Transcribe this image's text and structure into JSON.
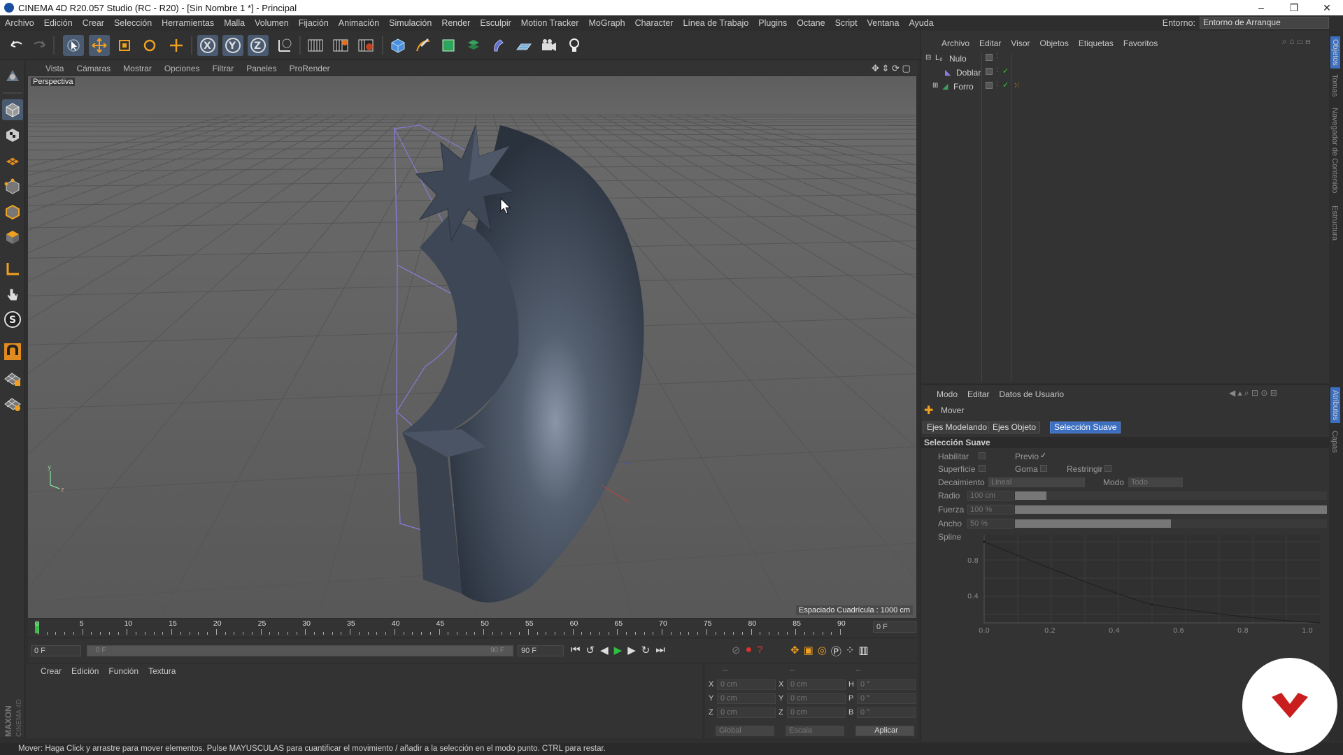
{
  "window": {
    "title": "CINEMA 4D R20.057 Studio (RC - R20) - [Sin Nombre 1 *] - Principal",
    "minimize": "–",
    "maximize": "❐",
    "close": "✕"
  },
  "mainmenu": [
    "Archivo",
    "Edición",
    "Crear",
    "Selección",
    "Herramientas",
    "Malla",
    "Volumen",
    "Fijación",
    "Animación",
    "Simulación",
    "Render",
    "Esculpir",
    "Motion Tracker",
    "MoGraph",
    "Character",
    "Línea de Trabajo",
    "Plugins",
    "Octane",
    "Script",
    "Ventana",
    "Ayuda"
  ],
  "entorno": {
    "label": "Entorno:",
    "value": "Entorno de Arranque"
  },
  "viewport": {
    "menu": [
      "Vista",
      "Cámaras",
      "Mostrar",
      "Opciones",
      "Filtrar",
      "Paneles",
      "ProRender"
    ],
    "label": "Perspectiva",
    "grid_info": "Espaciado Cuadrícula : 1000 cm"
  },
  "timeline": {
    "ticks": [
      "0",
      "5",
      "10",
      "15",
      "20",
      "25",
      "30",
      "35",
      "40",
      "45",
      "50",
      "55",
      "60",
      "65",
      "70",
      "75",
      "80",
      "85",
      "90"
    ],
    "end_field": "0 F"
  },
  "transport": {
    "start": "0 F",
    "range_start": "0 F",
    "range_end": "90 F",
    "end": "90 F"
  },
  "material": {
    "menu": [
      "Crear",
      "Edición",
      "Función",
      "Textura"
    ]
  },
  "coords": {
    "header": [
      "--",
      "--",
      "--"
    ],
    "rows": [
      {
        "a": "X",
        "av": "0 cm",
        "b": "X",
        "bv": "0 cm",
        "c": "H",
        "cv": "0 °"
      },
      {
        "a": "Y",
        "av": "0 cm",
        "b": "Y",
        "bv": "0 cm",
        "c": "P",
        "cv": "0 °"
      },
      {
        "a": "Z",
        "av": "0 cm",
        "b": "Z",
        "bv": "0 cm",
        "c": "B",
        "cv": "0 °"
      }
    ],
    "space": "Global",
    "mode": "Escala",
    "apply": "Aplicar"
  },
  "status": "Mover: Haga Click y arrastre para mover elementos. Pulse MAYUSCULAS para cuantificar el movimiento / añadir a la selección en el modo punto. CTRL para restar.",
  "objmgr": {
    "menu": [
      "Archivo",
      "Editar",
      "Visor",
      "Objetos",
      "Etiquetas",
      "Favoritos"
    ],
    "objects": [
      {
        "name": "Nulo"
      },
      {
        "name": "Doblar"
      },
      {
        "name": "Forro"
      }
    ]
  },
  "attr": {
    "menu": [
      "Modo",
      "Editar",
      "Datos de Usuario"
    ],
    "tool": "Mover",
    "tabs": [
      "Ejes Modelando",
      "Ejes Objeto",
      "Selección Suave"
    ],
    "section": "Selección Suave",
    "habilitar": "Habilitar",
    "previo": "Previo",
    "superficie": "Superficie",
    "goma": "Goma",
    "restringir": "Restringir",
    "decaimiento": "Decaimiento",
    "decaimiento_val": "Lineal",
    "modo": "Modo",
    "modo_val": "Todo",
    "radio": "Radio",
    "radio_val": "100 cm",
    "fuerza": "Fuerza",
    "fuerza_val": "100 %",
    "ancho": "Ancho",
    "ancho_val": "50 %",
    "spline": "Spline",
    "spline_y": [
      "0.8",
      "0.4",
      "0.0"
    ],
    "spline_x": [
      "0.2",
      "0.4",
      "0.6",
      "0.8",
      "1.0"
    ],
    "radio_fill": 0.1,
    "fuerza_fill": 1.0,
    "ancho_fill": 0.5
  },
  "rightstrip": [
    "Objetos",
    "Tomas",
    "Navegador de Contenido",
    "Estructura",
    "Atributos",
    "Capas"
  ],
  "brandmark": "MAXON CINEMA 4D"
}
